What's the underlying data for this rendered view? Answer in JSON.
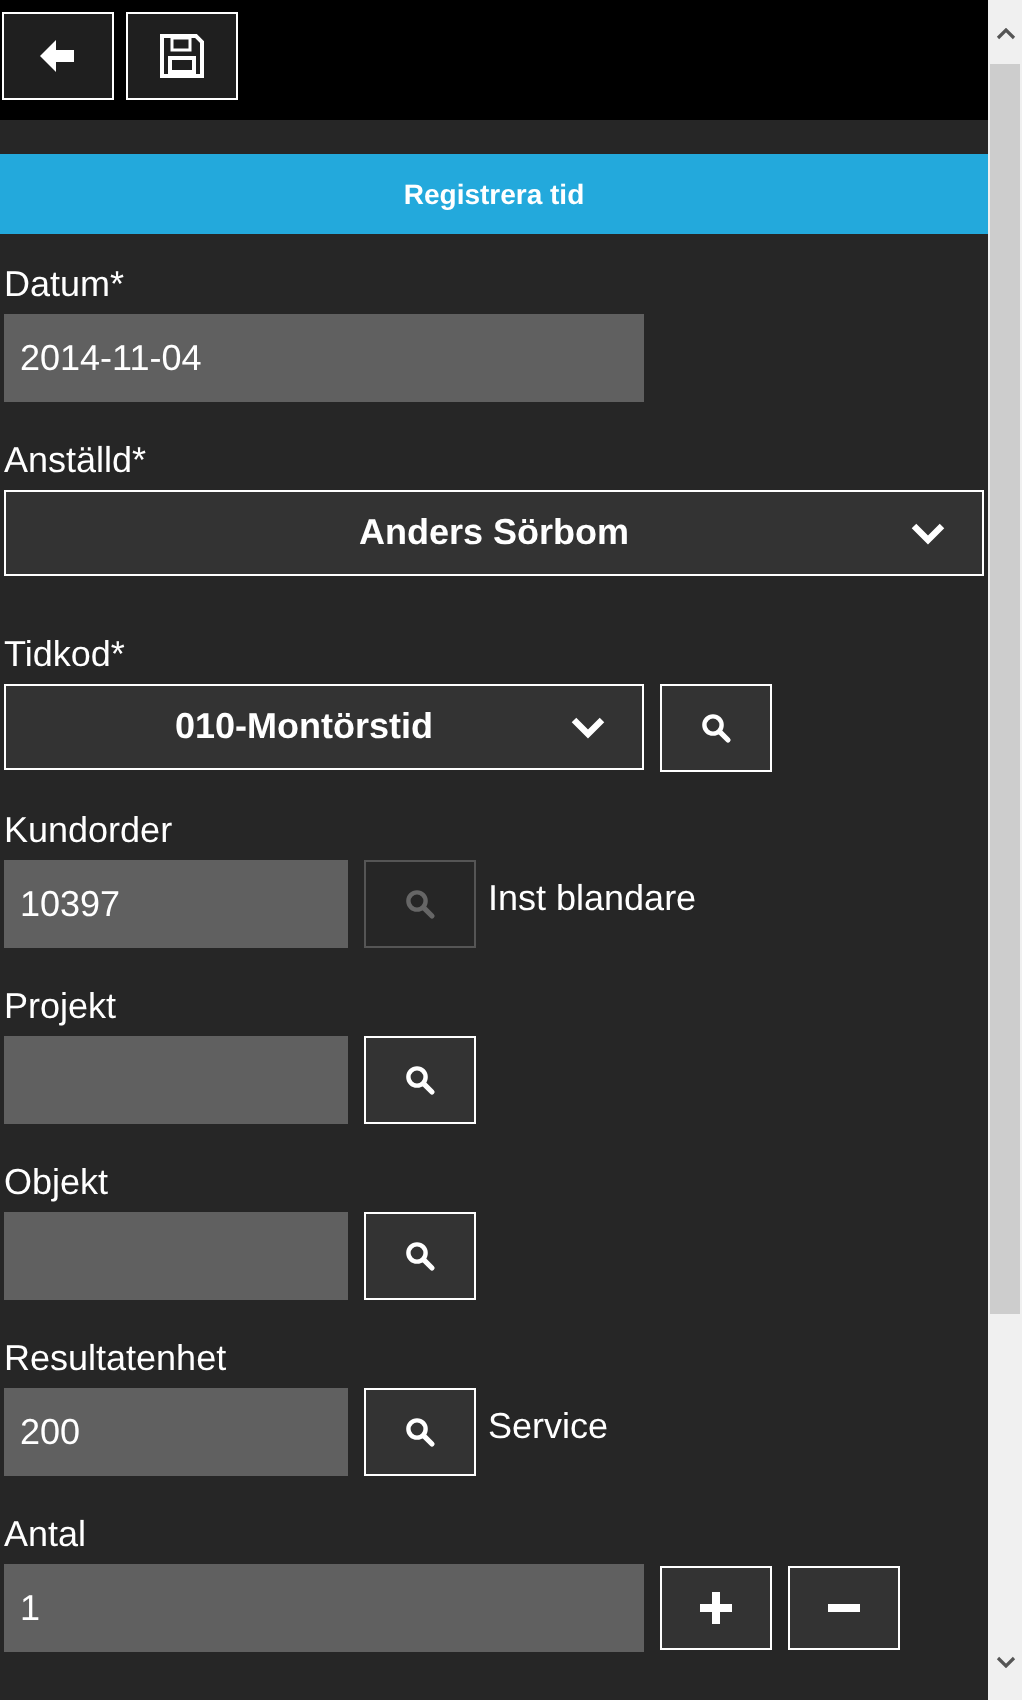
{
  "header": {
    "title": "Registrera tid"
  },
  "fields": [
    {
      "kind": "input",
      "label": "Datum*",
      "value": "2014-11-04"
    },
    {
      "kind": "select_wide",
      "label": "Anställd*",
      "value": "Anders Sörbom"
    },
    {
      "kind": "select_search",
      "label": "Tidkod*",
      "value": "010-Montörstid"
    },
    {
      "kind": "lookup",
      "label": "Kundorder",
      "value": "10397",
      "disabled": true,
      "note": "Inst blandare"
    },
    {
      "kind": "lookup",
      "label": "Projekt",
      "disabled": false
    },
    {
      "kind": "lookup",
      "label": "Objekt",
      "disabled": false
    },
    {
      "kind": "lookup",
      "label": "Resultatenhet",
      "value": "200",
      "disabled": false,
      "note": "Service"
    },
    {
      "kind": "counter",
      "label": "Antal",
      "value": "1"
    }
  ]
}
